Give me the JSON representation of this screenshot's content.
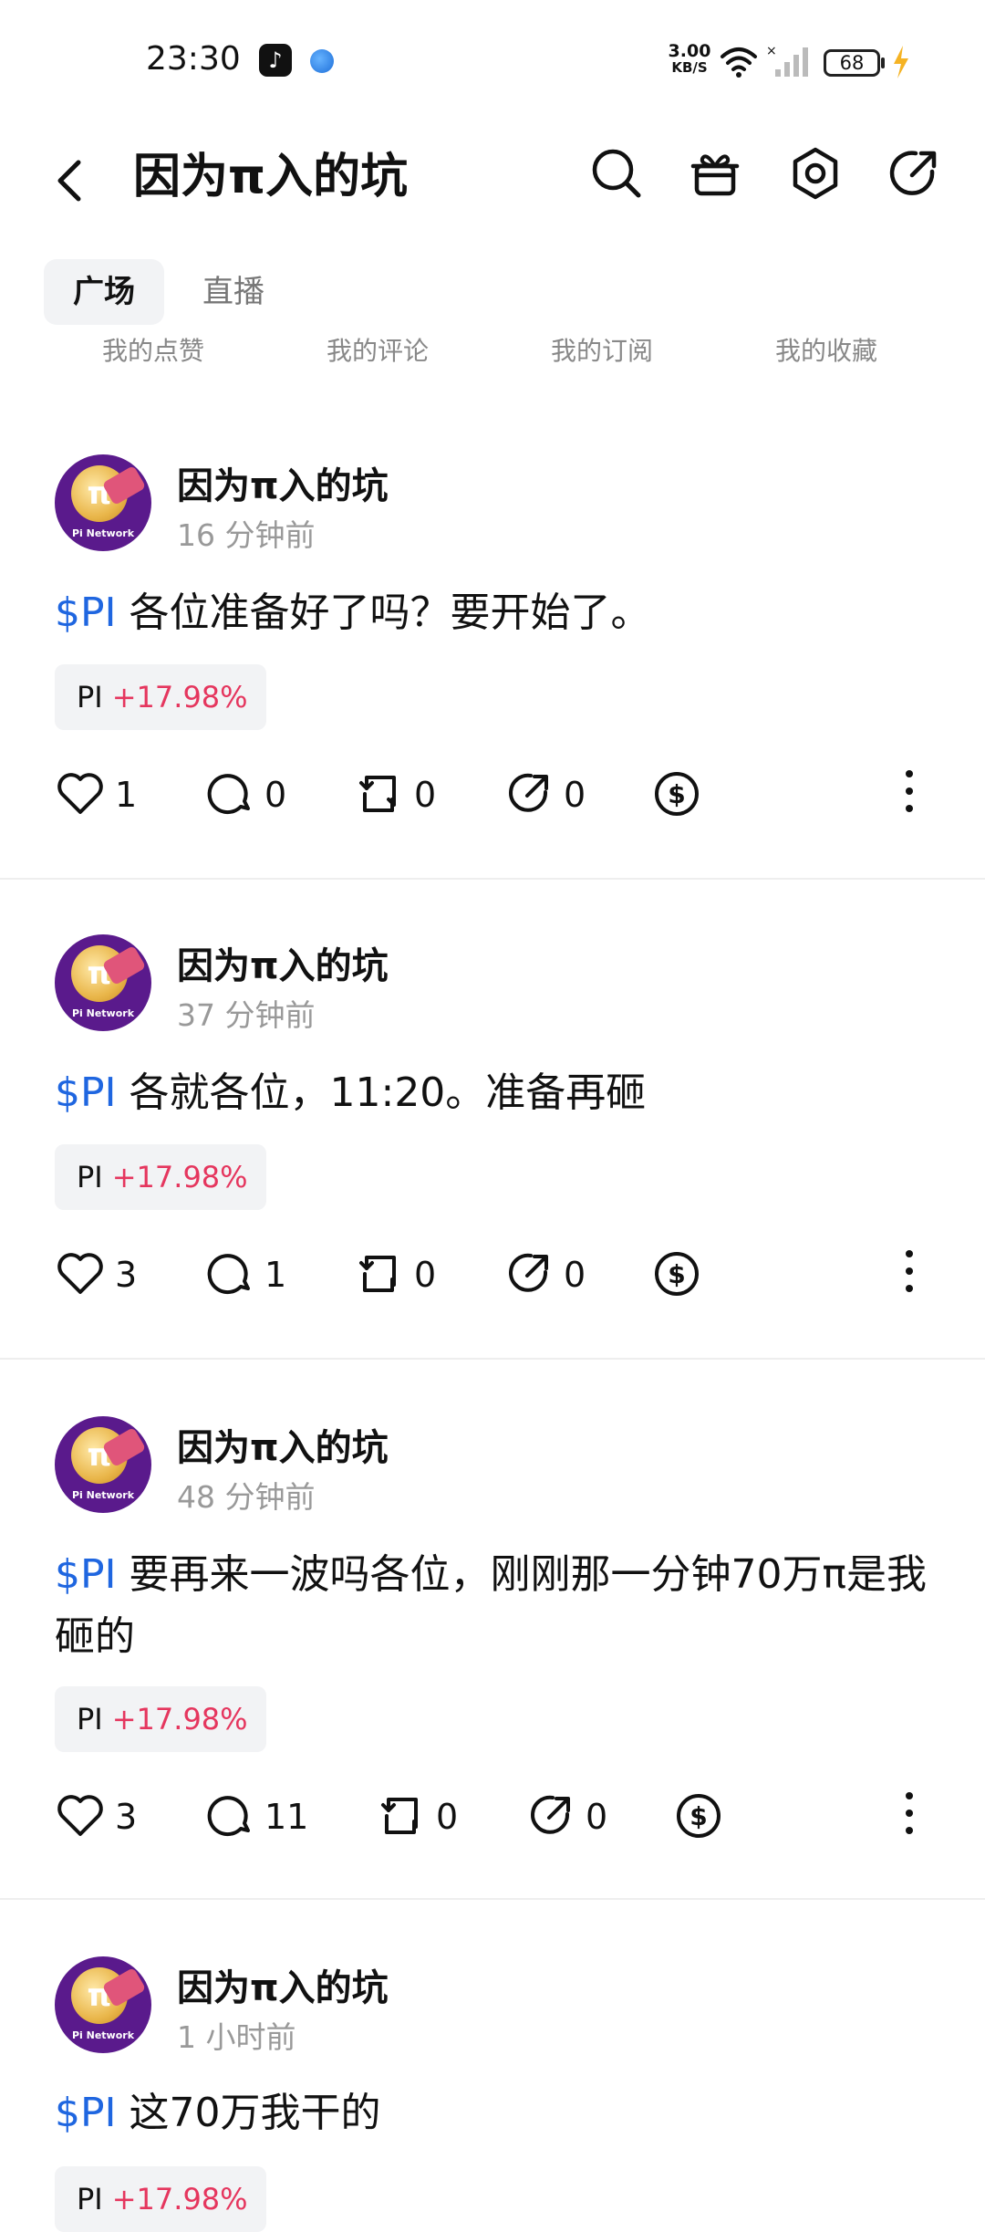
{
  "status_bar": {
    "time": "23:30",
    "net_speed_value": "3.00",
    "net_speed_unit": "KB/S",
    "battery": "68"
  },
  "header": {
    "title": "因为π入的坑",
    "icons": [
      "back-icon",
      "search-icon",
      "gift-icon",
      "settings-icon",
      "share-icon"
    ]
  },
  "tabs": {
    "active": "广场",
    "other": "直播"
  },
  "subtabs": [
    "我的点赞",
    "我的评论",
    "我的订阅",
    "我的收藏"
  ],
  "posts": [
    {
      "author": "因为π入的坑",
      "time": "16 分钟前",
      "tag": "$PI",
      "text": " 各位准备好了吗？要开始了。",
      "chip_symbol": "PI",
      "chip_change": "+17.98%",
      "likes": "1",
      "comments": "0",
      "reposts": "0",
      "shares": "0"
    },
    {
      "author": "因为π入的坑",
      "time": "37 分钟前",
      "tag": "$PI",
      "text": " 各就各位，11:20。准备再砸",
      "chip_symbol": "PI",
      "chip_change": "+17.98%",
      "likes": "3",
      "comments": "1",
      "reposts": "0",
      "shares": "0"
    },
    {
      "author": "因为π入的坑",
      "time": "48 分钟前",
      "tag": "$PI",
      "text": " 要再来一波吗各位，刚刚那一分钟70万π是我砸的",
      "chip_symbol": "PI",
      "chip_change": "+17.98%",
      "likes": "3",
      "comments": "11",
      "reposts": "0",
      "shares": "0"
    },
    {
      "author": "因为π入的坑",
      "time": "1 小时前",
      "tag": "$PI",
      "text": " 这70万我干的",
      "chip_symbol": "PI",
      "chip_change": "+17.98%"
    }
  ],
  "avatar_label": "Pi Network",
  "colors": {
    "tag_blue": "#1f66e0",
    "gain_red": "#e5365e",
    "muted_gray": "#999999"
  }
}
